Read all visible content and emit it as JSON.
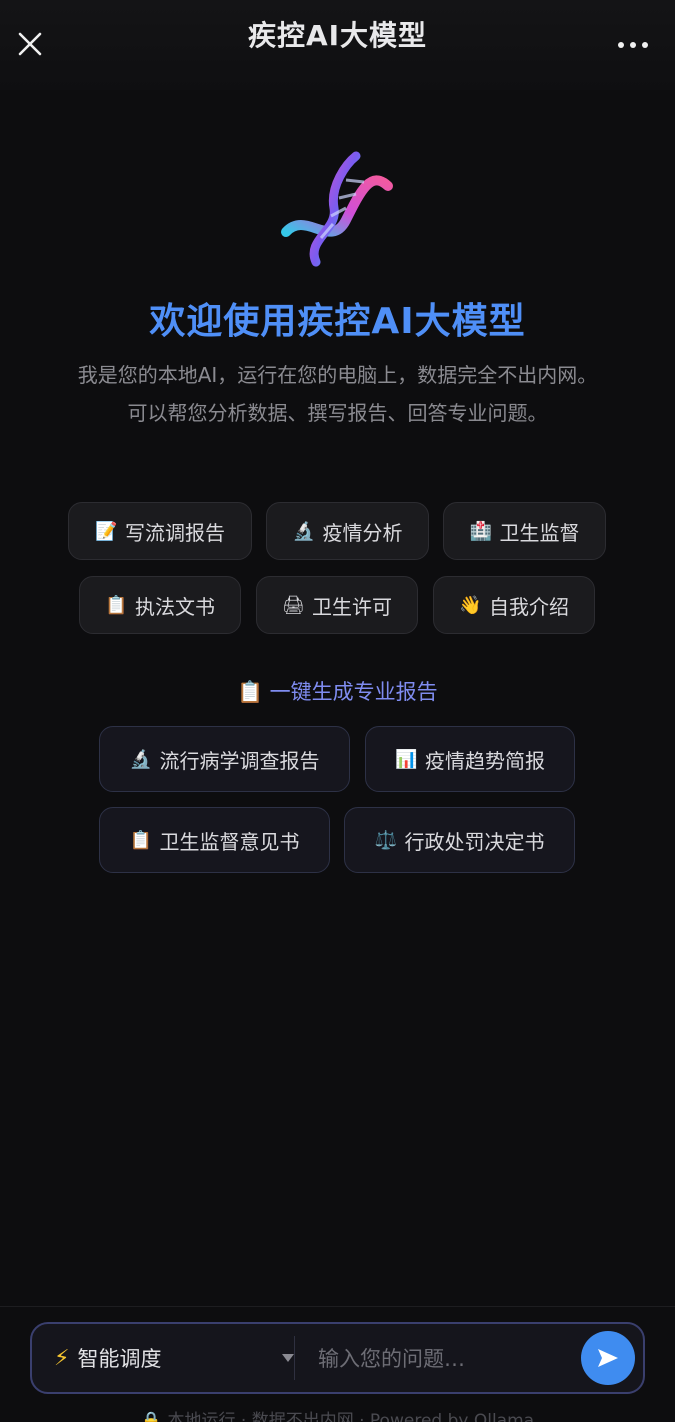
{
  "header": {
    "title": "疾控AI大模型",
    "close_icon": "close-icon",
    "more_icon": "more-dots-icon"
  },
  "hero": {
    "logo_icon": "dna-icon",
    "welcome": "欢迎使用疾控AI大模型",
    "desc_line1": "我是您的本地AI，运行在您的电脑上，数据完全不出内网。",
    "desc_line2": "可以帮您分析数据、撰写报告、回答专业问题。"
  },
  "quick_actions": [
    {
      "icon": "📝",
      "label": "写流调报告"
    },
    {
      "icon": "🔬",
      "label": "疫情分析"
    },
    {
      "icon": "🏥",
      "label": "卫生监督"
    },
    {
      "icon": "📋",
      "label": "执法文书"
    },
    {
      "icon": "🖨",
      "label": "卫生许可"
    },
    {
      "icon": "👋",
      "label": "自我介绍"
    }
  ],
  "reports": {
    "section_icon": "📋",
    "section_label": "一键生成专业报告",
    "items": [
      {
        "icon": "🔬",
        "label": "流行病学调查报告"
      },
      {
        "icon": "📊",
        "label": "疫情趋势简报"
      },
      {
        "icon": "📋",
        "label": "卫生监督意见书"
      },
      {
        "icon": "⚖️",
        "label": "行政处罚决定书"
      }
    ]
  },
  "composer": {
    "mode_icon": "⚡",
    "mode_label": "智能调度",
    "placeholder": "输入您的问题…",
    "send_icon": "send-icon"
  },
  "footer": {
    "text": "🔒 本地运行 · 数据不出内网 · Powered by Ollama"
  },
  "colors": {
    "background": "#0d0d0f",
    "accent_blue": "#4f8ff7",
    "section_purple": "#7f8cf0",
    "send_button": "#3f8cf0"
  }
}
